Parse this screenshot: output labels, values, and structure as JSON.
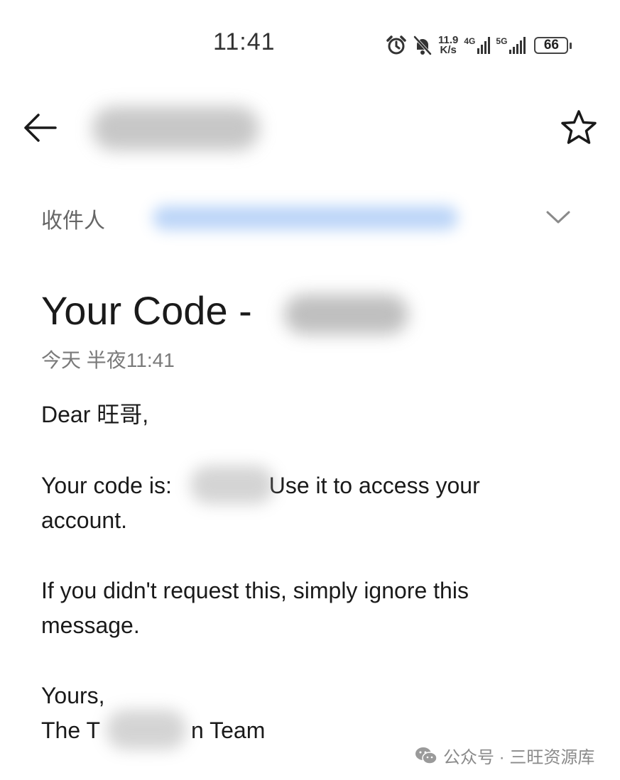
{
  "status_bar": {
    "time": "11:41",
    "net_speed_value": "11.9",
    "net_speed_unit": "K/s",
    "signal_1_label": "4G",
    "signal_2_label": "5G",
    "battery": "66"
  },
  "header": {
    "back_icon": "arrow-left-icon",
    "star_icon": "star-outline-icon"
  },
  "recipient": {
    "label": "收件人",
    "expand_icon": "chevron-down-icon"
  },
  "email": {
    "subject": "Your Code -",
    "date": "今天 半夜11:41",
    "greeting": "Dear 旺哥,",
    "code_prefix": "Your code is:",
    "code_suffix": " Use it to access your",
    "code_line2": "account.",
    "ignore_line1": "If you didn't request this, simply ignore this",
    "ignore_line2": "message.",
    "signoff": "Yours,",
    "team_prefix": "The T",
    "team_suffix": "n Team"
  },
  "watermark": {
    "icon": "wechat-icon",
    "text": "公众号 · 三旺资源库"
  }
}
